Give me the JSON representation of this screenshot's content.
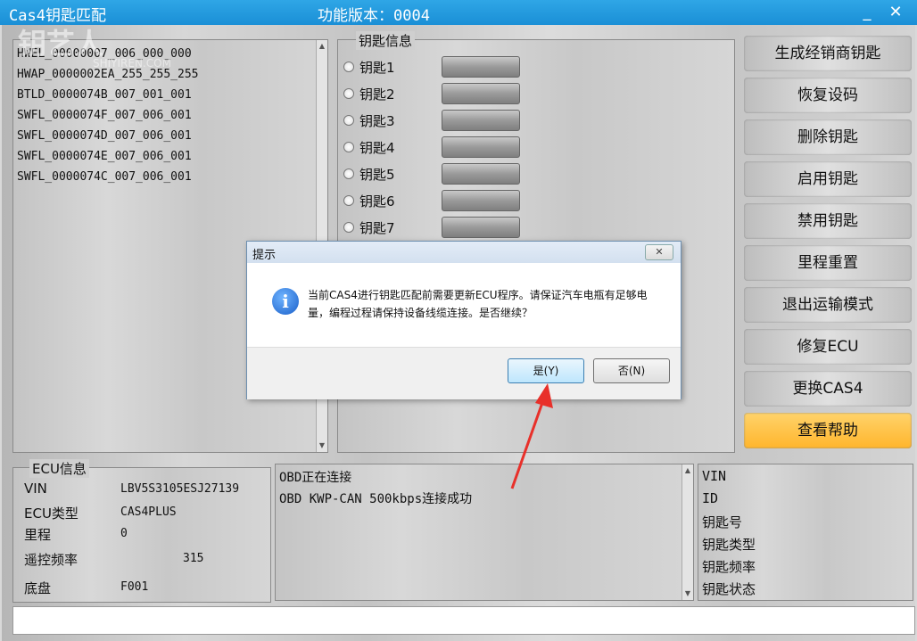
{
  "window": {
    "title": "Cas4钥匙匹配",
    "version": "功能版本：0004",
    "minimize": "_",
    "close": "✕"
  },
  "watermark": {
    "text": "钥艺人",
    "sub": "SHIYIREN.COM"
  },
  "key_list": [
    "HWEL_00000007_006_000_000",
    "HWAP_0000002EA_255_255_255",
    "BTLD_0000074B_007_001_001",
    "SWFL_0000074F_007_006_001",
    "SWFL_0000074D_007_006_001",
    "SWFL_0000074E_007_006_001",
    "SWFL_0000074C_007_006_001"
  ],
  "key_info": {
    "legend": "钥匙信息",
    "keys": [
      "钥匙1",
      "钥匙2",
      "钥匙3",
      "钥匙4",
      "钥匙5",
      "钥匙6",
      "钥匙7"
    ]
  },
  "actions": [
    "生成经销商钥匙",
    "恢复设码",
    "删除钥匙",
    "启用钥匙",
    "禁用钥匙",
    "里程重置",
    "退出运输模式",
    "修复ECU",
    "更换CAS4",
    "查看帮助"
  ],
  "ecu": {
    "legend": "ECU信息",
    "rows": [
      {
        "label": "VIN",
        "value": "LBV5S3105ESJ27139"
      },
      {
        "label": "ECU类型",
        "value": "CAS4PLUS"
      },
      {
        "label": "里程",
        "value": "0"
      },
      {
        "label": "遥控频率",
        "value": "315"
      },
      {
        "label": "底盘",
        "value": "F001"
      }
    ]
  },
  "log": [
    "OBD正在连接",
    "OBD  KWP-CAN  500kbps连接成功"
  ],
  "key_detail": [
    "VIN",
    "ID",
    "钥匙号",
    "钥匙类型",
    "钥匙频率",
    "钥匙状态"
  ],
  "dialog": {
    "title": "提示",
    "message": "当前CAS4进行钥匙匹配前需要更新ECU程序。请保证汽车电瓶有足够电量，编程过程请保持设备线缆连接。是否继续？",
    "yes": "是(Y)",
    "no": "否(N)",
    "close": "✕",
    "icon": "i"
  },
  "colors": {
    "titlebar": "#1a8fd6",
    "help_button": "#ffb52c",
    "arrow": "#e8302a"
  }
}
